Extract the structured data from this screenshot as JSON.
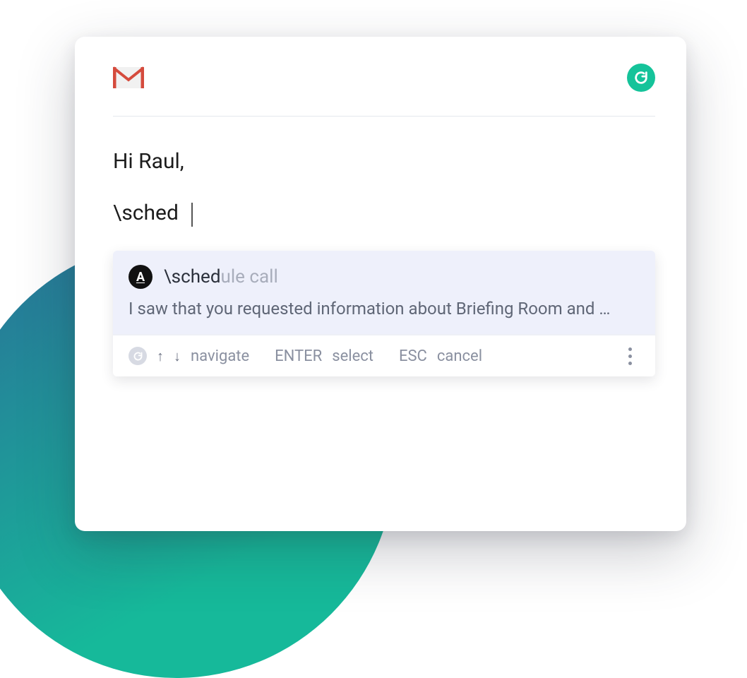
{
  "body": {
    "greeting": "Hi Raul,",
    "typed": "\\sched"
  },
  "suggestion": {
    "icon_letter": "A",
    "command_typed": "\\sched",
    "command_rest": "ule call",
    "preview": "I saw that you requested information about Briefing Room and …"
  },
  "hints": {
    "navigate": "navigate",
    "enter_key": "ENTER",
    "enter_action": "select",
    "esc_key": "ESC",
    "esc_action": "cancel"
  }
}
